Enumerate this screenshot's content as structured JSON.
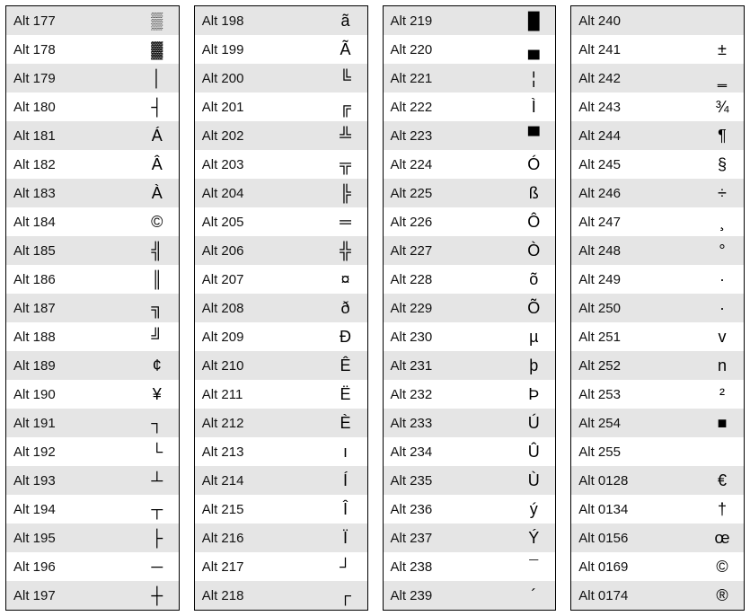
{
  "columns": [
    [
      {
        "code": "Alt 177",
        "char": "▒"
      },
      {
        "code": "Alt 178",
        "char": "▓"
      },
      {
        "code": "Alt 179",
        "char": "│"
      },
      {
        "code": "Alt 180",
        "char": "┤"
      },
      {
        "code": "Alt 181",
        "char": "Á"
      },
      {
        "code": "Alt 182",
        "char": "Â"
      },
      {
        "code": "Alt 183",
        "char": "À"
      },
      {
        "code": "Alt 184",
        "char": "©"
      },
      {
        "code": "Alt 185",
        "char": "╣"
      },
      {
        "code": "Alt 186",
        "char": "║"
      },
      {
        "code": "Alt 187",
        "char": "╗"
      },
      {
        "code": "Alt 188",
        "char": "╝"
      },
      {
        "code": "Alt 189",
        "char": "¢"
      },
      {
        "code": "Alt 190",
        "char": "¥"
      },
      {
        "code": "Alt 191",
        "char": "┐"
      },
      {
        "code": "Alt 192",
        "char": "└"
      },
      {
        "code": "Alt 193",
        "char": "┴"
      },
      {
        "code": "Alt 194",
        "char": "┬"
      },
      {
        "code": "Alt 195",
        "char": "├"
      },
      {
        "code": "Alt 196",
        "char": "─"
      },
      {
        "code": "Alt 197",
        "char": "┼"
      }
    ],
    [
      {
        "code": "Alt 198",
        "char": "ã"
      },
      {
        "code": "Alt 199",
        "char": "Ã"
      },
      {
        "code": "Alt 200",
        "char": "╚"
      },
      {
        "code": "Alt 201",
        "char": "╔"
      },
      {
        "code": "Alt 202",
        "char": "╩"
      },
      {
        "code": "Alt 203",
        "char": "╦"
      },
      {
        "code": "Alt 204",
        "char": "╠"
      },
      {
        "code": "Alt 205",
        "char": "═"
      },
      {
        "code": "Alt 206",
        "char": "╬"
      },
      {
        "code": "Alt 207",
        "char": "¤"
      },
      {
        "code": "Alt 208",
        "char": "ð"
      },
      {
        "code": "Alt 209",
        "char": "Ð"
      },
      {
        "code": "Alt 210",
        "char": "Ê"
      },
      {
        "code": "Alt 211",
        "char": "Ë"
      },
      {
        "code": "Alt 212",
        "char": "È"
      },
      {
        "code": "Alt 213",
        "char": "ı"
      },
      {
        "code": "Alt 214",
        "char": "Í"
      },
      {
        "code": "Alt 215",
        "char": "Î"
      },
      {
        "code": "Alt 216",
        "char": "Ï"
      },
      {
        "code": "Alt 217",
        "char": "┘"
      },
      {
        "code": "Alt 218",
        "char": "┌"
      }
    ],
    [
      {
        "code": "Alt 219",
        "char": "█"
      },
      {
        "code": "Alt 220",
        "char": "▄"
      },
      {
        "code": "Alt 221",
        "char": "¦"
      },
      {
        "code": "Alt 222",
        "char": "Ì"
      },
      {
        "code": "Alt 223",
        "char": "▀"
      },
      {
        "code": "Alt 224",
        "char": "Ó"
      },
      {
        "code": "Alt 225",
        "char": "ß"
      },
      {
        "code": "Alt 226",
        "char": "Ô"
      },
      {
        "code": "Alt 227",
        "char": "Ò"
      },
      {
        "code": "Alt 228",
        "char": "õ"
      },
      {
        "code": "Alt 229",
        "char": "Õ"
      },
      {
        "code": "Alt 230",
        "char": "µ"
      },
      {
        "code": "Alt 231",
        "char": "þ"
      },
      {
        "code": "Alt 232",
        "char": "Þ"
      },
      {
        "code": "Alt 233",
        "char": "Ú"
      },
      {
        "code": "Alt 234",
        "char": "Û"
      },
      {
        "code": "Alt 235",
        "char": "Ù"
      },
      {
        "code": "Alt 236",
        "char": "ý"
      },
      {
        "code": "Alt 237",
        "char": "Ý"
      },
      {
        "code": "Alt 238",
        "char": "¯"
      },
      {
        "code": "Alt 239",
        "char": "´"
      }
    ],
    [
      {
        "code": "Alt 240",
        "char": ""
      },
      {
        "code": "Alt 241",
        "char": "±"
      },
      {
        "code": "Alt 242",
        "char": "‗"
      },
      {
        "code": "Alt 243",
        "char": "¾"
      },
      {
        "code": "Alt 244",
        "char": "¶"
      },
      {
        "code": "Alt 245",
        "char": "§"
      },
      {
        "code": "Alt 246",
        "char": "÷"
      },
      {
        "code": "Alt 247",
        "char": "¸"
      },
      {
        "code": "Alt 248",
        "char": "°"
      },
      {
        "code": "Alt 249",
        "char": "·"
      },
      {
        "code": "Alt 250",
        "char": "·"
      },
      {
        "code": "Alt 251",
        "char": "v"
      },
      {
        "code": "Alt 252",
        "char": "n"
      },
      {
        "code": "Alt 253",
        "char": "²"
      },
      {
        "code": "Alt 254",
        "char": "■"
      },
      {
        "code": "Alt 255",
        "char": ""
      },
      {
        "code": "Alt 0128",
        "char": "€"
      },
      {
        "code": "Alt 0134",
        "char": "†"
      },
      {
        "code": "Alt 0156",
        "char": "œ"
      },
      {
        "code": "Alt 0169",
        "char": "©"
      },
      {
        "code": "Alt 0174",
        "char": "®"
      }
    ]
  ]
}
